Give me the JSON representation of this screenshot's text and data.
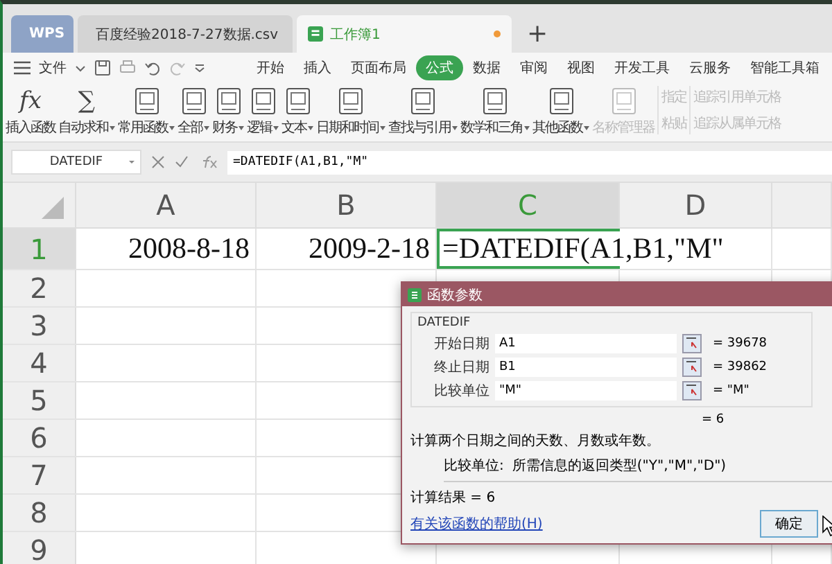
{
  "tabs": [
    {
      "label": "WPS",
      "kind": "app",
      "selected": false
    },
    {
      "label": "百度经验2018-7-27数据.csv",
      "kind": "file",
      "selected": false
    },
    {
      "label": "工作簿1",
      "kind": "file",
      "selected": true
    }
  ],
  "new_tab": "+",
  "menu": {
    "file": "文件",
    "tabs": [
      {
        "label": "开始",
        "selected": false
      },
      {
        "label": "插入",
        "selected": false
      },
      {
        "label": "页面布局",
        "selected": false
      },
      {
        "label": "公式",
        "selected": true
      },
      {
        "label": "数据",
        "selected": false
      },
      {
        "label": "审阅",
        "selected": false
      },
      {
        "label": "视图",
        "selected": false
      },
      {
        "label": "开发工具",
        "selected": false
      },
      {
        "label": "云服务",
        "selected": false
      },
      {
        "label": "智能工具箱",
        "selected": false
      }
    ]
  },
  "ribbon": [
    {
      "label": "插入函数",
      "kind": "glyph",
      "glyph": "fx",
      "dropdown": false,
      "disabled": false
    },
    {
      "label": "自动求和",
      "kind": "glyph",
      "glyph": "∑",
      "dropdown": true,
      "disabled": false
    },
    {
      "label": "常用函数",
      "kind": "book",
      "dropdown": true,
      "disabled": false
    },
    {
      "label": "全部",
      "kind": "book",
      "dropdown": true,
      "disabled": false
    },
    {
      "label": "财务",
      "kind": "book",
      "dropdown": true,
      "disabled": false
    },
    {
      "label": "逻辑",
      "kind": "book",
      "dropdown": true,
      "disabled": false
    },
    {
      "label": "文本",
      "kind": "book",
      "dropdown": true,
      "disabled": false
    },
    {
      "label": "日期和时间",
      "kind": "book",
      "dropdown": true,
      "disabled": false
    },
    {
      "label": "查找与引用",
      "kind": "book",
      "dropdown": true,
      "disabled": false
    },
    {
      "label": "数学和三角",
      "kind": "book",
      "dropdown": true,
      "disabled": false
    },
    {
      "label": "其他函数",
      "kind": "book",
      "dropdown": true,
      "disabled": false
    },
    {
      "label": "名称管理器",
      "kind": "book",
      "dropdown": false,
      "disabled": true
    }
  ],
  "ribbon_small": [
    {
      "label": "指定",
      "disabled": true
    },
    {
      "label": "粘贴",
      "disabled": true
    },
    {
      "label": "追踪引用单元格",
      "disabled": true
    },
    {
      "label": "追踪从属单元格",
      "disabled": true
    }
  ],
  "formula_bar": {
    "name_box": "DATEDIF",
    "formula": "=DATEDIF(A1,B1,\"M\""
  },
  "sheet": {
    "columns": [
      {
        "label": "A",
        "selected": false
      },
      {
        "label": "B",
        "selected": false
      },
      {
        "label": "C",
        "selected": true
      },
      {
        "label": "D",
        "selected": false
      }
    ],
    "rows": [
      {
        "label": "1",
        "cells": [
          "2008-8-18",
          "2009-2-18",
          "=DATEDIF(A1,B1,\"M\""
        ]
      },
      {
        "label": "2",
        "cells": []
      },
      {
        "label": "3",
        "cells": []
      },
      {
        "label": "4",
        "cells": []
      },
      {
        "label": "5",
        "cells": []
      },
      {
        "label": "6",
        "cells": []
      },
      {
        "label": "7",
        "cells": []
      },
      {
        "label": "8",
        "cells": []
      },
      {
        "label": "9",
        "cells": []
      }
    ]
  },
  "dialog": {
    "title": "函数参数",
    "function": "DATEDIF",
    "args": [
      {
        "label": "开始日期",
        "value": "A1",
        "result": "= 39678"
      },
      {
        "label": "终止日期",
        "value": "B1",
        "result": "= 39862"
      },
      {
        "label": "比较单位",
        "value": "\"M\"",
        "result": "= \"M\""
      }
    ],
    "result": "= 6",
    "description": "计算两个日期之间的天数、月数或年数。",
    "arg_help_label": "比较单位:",
    "arg_help": "所需信息的返回类型(\"Y\",\"M\",\"D\")",
    "calc_result": "计算结果 = 6",
    "help_link": "有关该函数的帮助(H)",
    "ok": "确定"
  }
}
